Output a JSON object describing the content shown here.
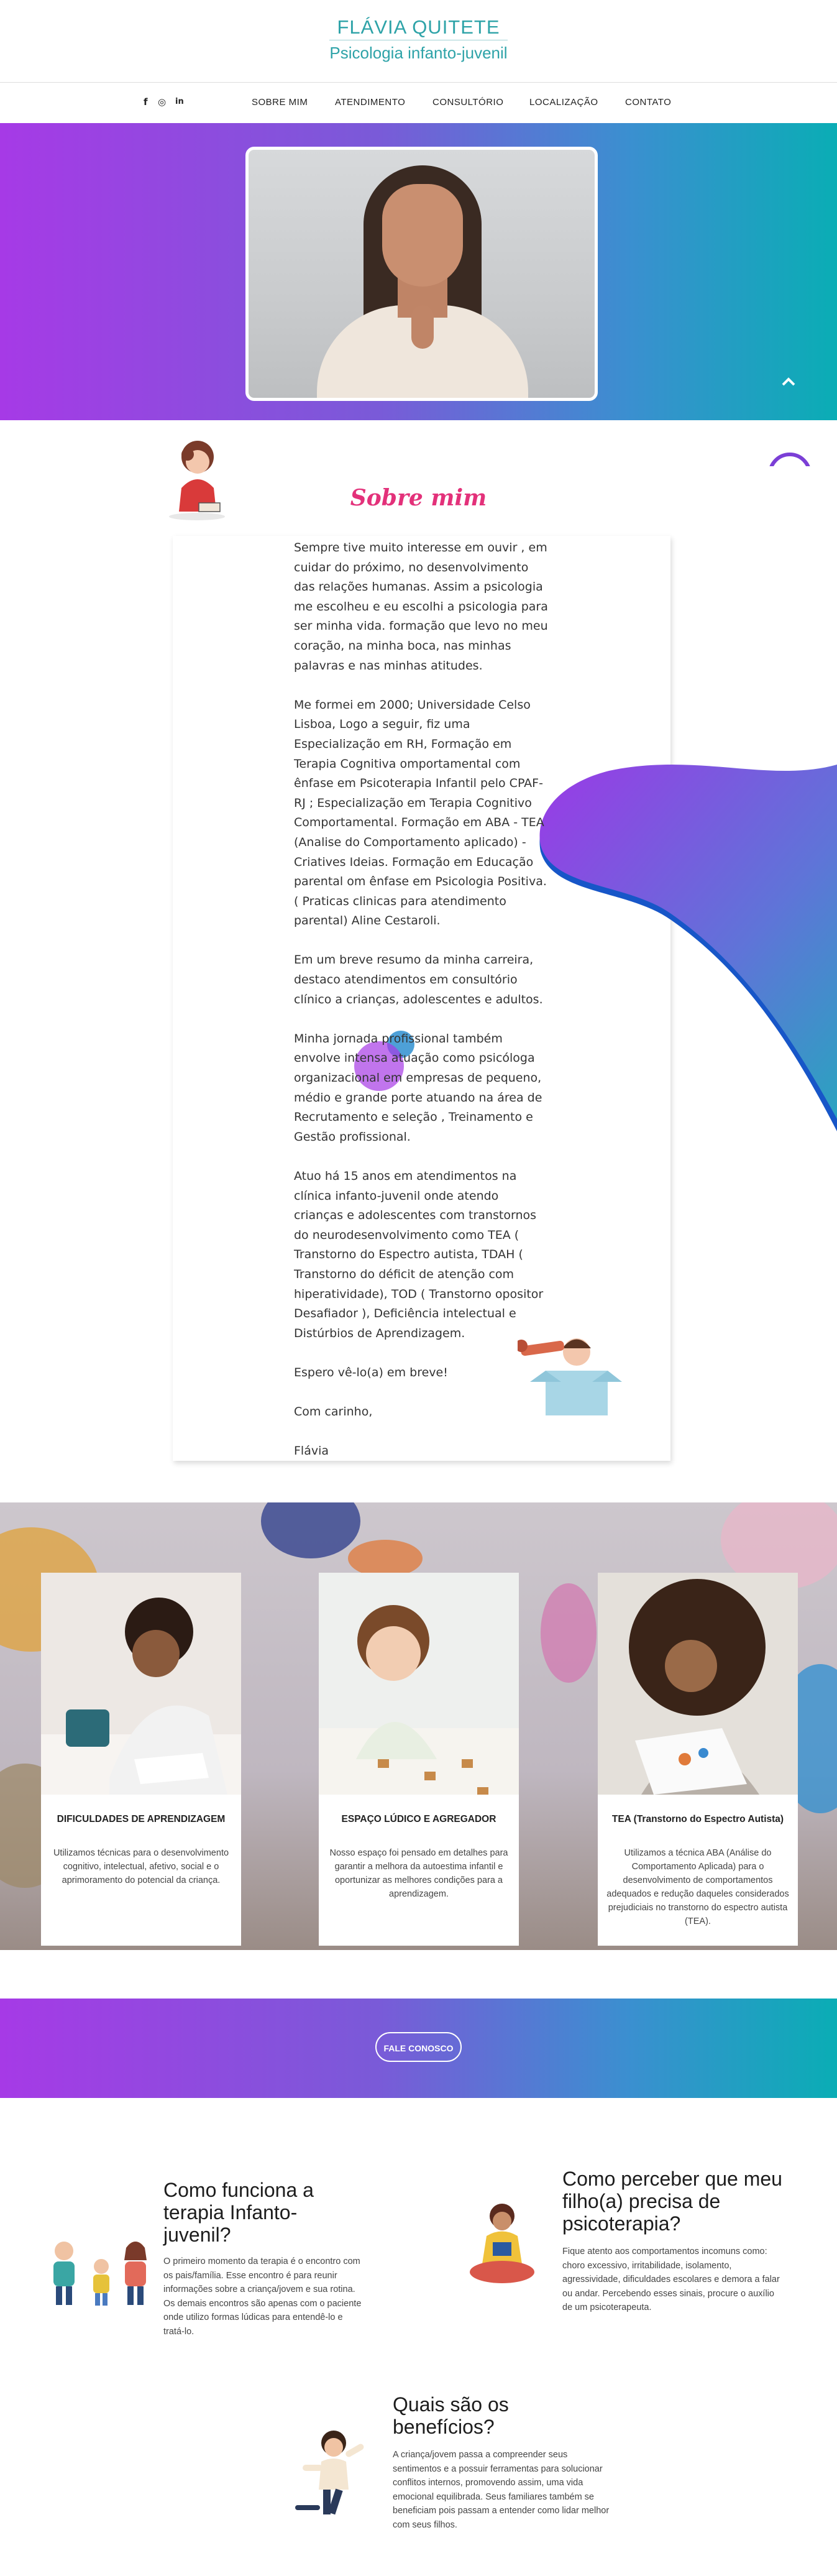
{
  "header": {
    "brand_name": "FLÁVIA QUITETE",
    "brand_subtitle": "Psicologia infanto-juvenil"
  },
  "social": {
    "facebook": "f",
    "instagram": "◎",
    "linkedin": "in"
  },
  "nav": {
    "items": [
      {
        "label": "SOBRE MIM"
      },
      {
        "label": "ATENDIMENTO"
      },
      {
        "label": "CONSULTÓRIO"
      },
      {
        "label": "LOCALIZAÇÃO"
      },
      {
        "label": "CONTATO"
      }
    ]
  },
  "hero": {
    "scroll_top_icon": "chevron-up-icon"
  },
  "about": {
    "title": "Sobre mim",
    "paragraphs": [
      "Sempre tive muito interesse em ouvir , em\ncuidar do próximo, no desenvolvimento\ndas relações humanas. Assim a psicologia\nme escolheu e eu escolhi a psicologia para\nser minha vida. formação que levo no meu\ncoração, na minha boca, nas minhas\npalavras e nas minhas atitudes.",
      "Me formei em 2000; Universidade Celso\nLisboa, Logo a seguir, fiz uma\nEspecialização em RH, Formação em\nTerapia Cognitiva omportamental com\nênfase em Psicoterapia Infantil pelo  CPAF-\nRJ ; Especialização em Terapia Cognitivo\nComportamental. Formação em ABA - TEA\n(Analise do Comportamento aplicado) -\nCriatives Ideias. Formação em Educação\nparental om ênfase em Psicologia Positiva.\n( Praticas clinicas para atendimento\nparental) Aline Cestaroli.",
      "Em um breve resumo da minha carreira,\ndestaco atendimentos em consultório\nclínico a crianças, adolescentes e adultos.",
      "Minha jornada profissional também\nenvolve intensa atuação como psicóloga\norganizacional em empresas de pequeno,\nmédio e grande porte atuando na área de\nRecrutamento e seleção , Treinamento e\nGestão profissional.",
      "Atuo há 15 anos em atendimentos na\nclínica infanto-juvenil onde atendo\ncrianças e adolescentes com transtornos\ndo neurodesenvolvimento como TEA (\nTranstorno do Espectro autista, TDAH (\nTranstorno do déficit de atenção com\nhiperatividade), TOD ( Transtorno opositor\nDesafiador ), Deficiência intelectual e\nDistúrbios de Aprendizagem.",
      "Espero vê-lo(a) em breve!",
      "Com carinho,",
      "Flávia"
    ]
  },
  "services": [
    {
      "title": "DIFICULDADES DE APRENDIZAGEM",
      "description": "Utilizamos técnicas para o desenvolvimento cognitivo, intelectual, afetivo, social e o aprimoramento do potencial da criança."
    },
    {
      "title": "ESPAÇO LÚDICO E AGREGADOR",
      "description": "Nosso espaço foi pensado em detalhes para garantir a melhora da autoestima infantil e oportunizar as melhores condições para a aprendizagem."
    },
    {
      "title": "TEA (Transtorno do Espectro Autista)",
      "description": "Utilizamos a técnica ABA (Análise do Comportamento Aplicada) para o desenvolvimento de comportamentos adequados e redução daqueles considerados prejudiciais no transtorno do espectro autista (TEA)."
    }
  ],
  "cta": {
    "button_label": "FALE CONOSCO"
  },
  "info": {
    "how": {
      "title": "Como funciona a terapia Infanto-juvenil?",
      "text": "O primeiro momento da terapia é o encontro com os pais/família. Esse encontro é para reunir informações sobre a criança/jovem e sua rotina. Os demais encontros são apenas com o paciente onde utilizo formas lúdicas para entendê-lo e tratá-lo."
    },
    "perceive": {
      "title": "Como perceber que meu filho(a) precisa de psicoterapia?",
      "text": "Fique atento aos comportamentos incomuns como: choro excessivo, irritabilidade, isolamento, agressividade, dificuldades escolares e demora a falar ou andar. Percebendo esses sinais, procure o auxílio de um psicoterapeuta."
    },
    "benefits": {
      "title": "Quais são os benefícios?",
      "text": "A criança/jovem passa a compreender seus sentimentos e a possuir ferramentas para solucionar conflitos internos, promovendo assim, uma vida emocional equilibrada. Seus familiares também se beneficiam pois passam a entender como lidar melhor com seus filhos."
    }
  },
  "colors": {
    "brand_teal": "#2ea3a8",
    "title_pink": "#e3317a",
    "gradient_start": "#a63ae6",
    "gradient_end": "#0aadb5"
  }
}
